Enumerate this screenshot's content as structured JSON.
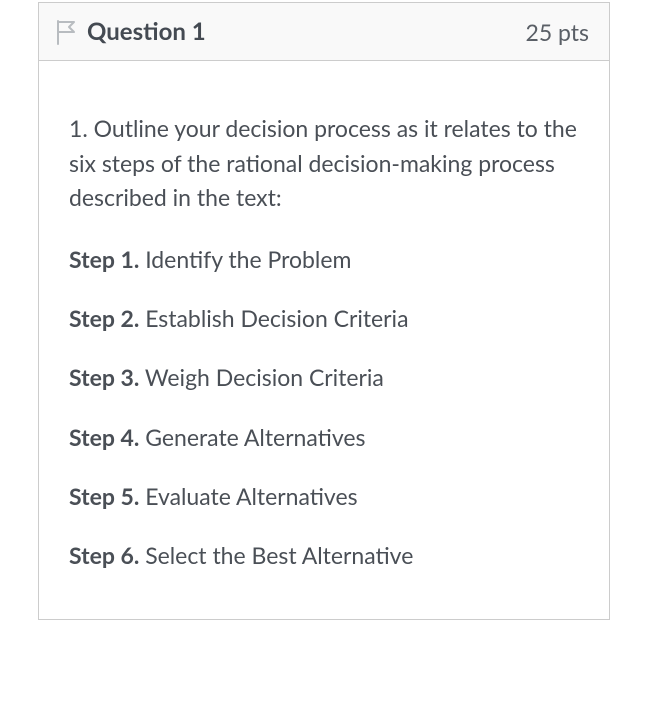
{
  "question": {
    "title": "Question 1",
    "points": "25 pts",
    "prompt": "1. Outline your decision process as it relates to the six steps of the rational decision-making process described in the text:",
    "steps": [
      {
        "label": "Step 1.",
        "text": " Identify the Problem"
      },
      {
        "label": "Step 2.",
        "text": " Establish Decision Criteria"
      },
      {
        "label": "Step 3.",
        "text": " Weigh Decision Criteria"
      },
      {
        "label": "Step 4.",
        "text": " Generate Alternatives"
      },
      {
        "label": "Step 5.",
        "text": " Evaluate Alternatives"
      },
      {
        "label": "Step 6.",
        "text": " Select the Best Alternative"
      }
    ]
  }
}
